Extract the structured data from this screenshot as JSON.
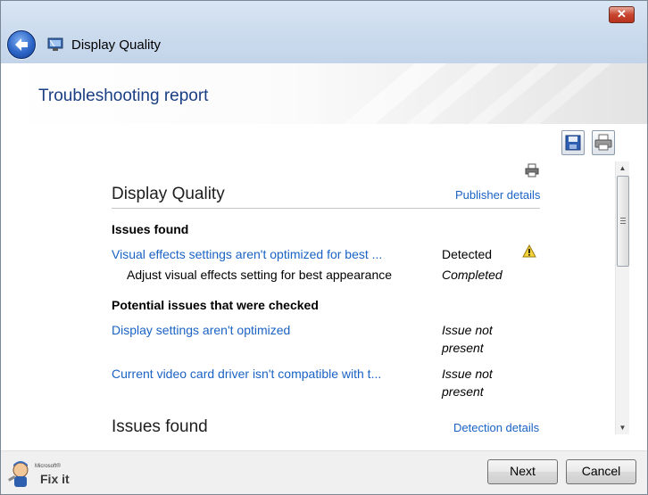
{
  "window": {
    "title": "Display Quality",
    "close_label": "✕"
  },
  "header": {
    "title": "Troubleshooting report"
  },
  "toolbar": {
    "save_icon": "save-icon",
    "print_icon": "printer-icon"
  },
  "report": {
    "heading": "Display Quality",
    "publisher_link": "Publisher details",
    "issues_found_label": "Issues found",
    "issues": [
      {
        "title": "Visual effects settings aren't optimized for best ...",
        "status": "Detected",
        "icon": "warning-icon"
      }
    ],
    "resolutions": [
      {
        "text": "Adjust visual effects setting for best appearance",
        "status": "Completed"
      }
    ],
    "potential_label": "Potential issues that were checked",
    "checked": [
      {
        "title": "Display settings aren't optimized",
        "status_line1": "Issue not",
        "status_line2": "present"
      },
      {
        "title": "Current video card driver isn't compatible with t...",
        "status_line1": "Issue not",
        "status_line2": "present"
      }
    ],
    "section2_heading": "Issues found",
    "detection_link": "Detection details"
  },
  "footer": {
    "logo_small": "Microsoft®",
    "logo_main": "Fix it",
    "next_label": "Next",
    "cancel_label": "Cancel"
  }
}
